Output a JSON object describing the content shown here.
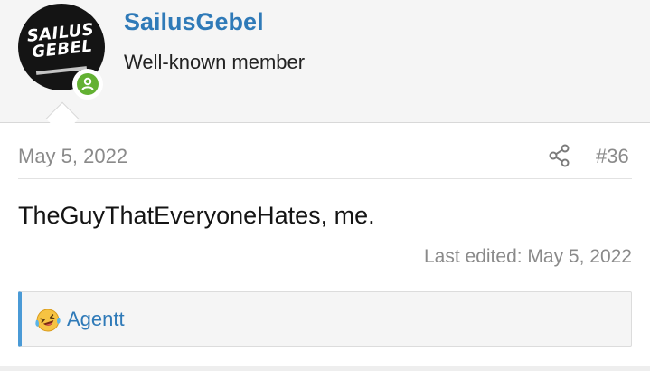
{
  "user": {
    "name": "SailusGebel",
    "title": "Well-known member",
    "avatar_text": "SAILUS GEBEL",
    "online": true
  },
  "post": {
    "date": "May 5, 2022",
    "number": "#36",
    "message": "TheGuyThatEveryoneHates, me.",
    "last_edited": "Last edited: May 5, 2022"
  },
  "reactions": {
    "icon": "laughing-tears-emoji-icon",
    "user": "Agentt"
  },
  "colors": {
    "link": "#2f7ab8",
    "online": "#63b133",
    "reaction_accent": "#4a9ad6",
    "muted": "#8a8a8a"
  }
}
